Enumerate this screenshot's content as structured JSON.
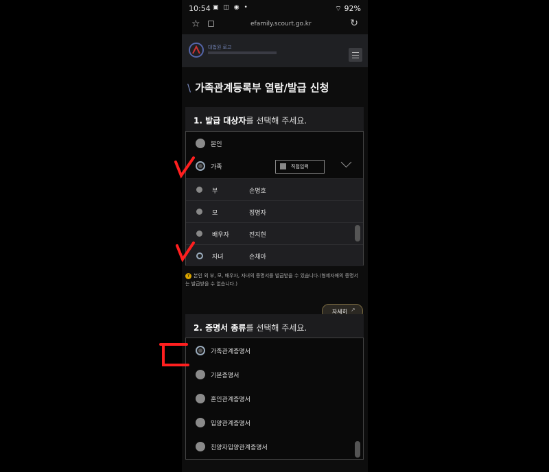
{
  "status_bar": {
    "time": "10:54",
    "battery": "92%"
  },
  "browser": {
    "url": "efamily.scourt.go.kr"
  },
  "site": {
    "logo_text": "대법원 로고"
  },
  "page": {
    "title": "가족관계등록부 열람/발급 신청"
  },
  "section1": {
    "heading_bold": "1. 발급 대상자",
    "heading_rest": "를 선택해 주세요.",
    "options": [
      {
        "label": "본인",
        "selected": false
      },
      {
        "label": "가족",
        "selected": true
      }
    ],
    "direct_input_label": "직접입력",
    "family_members": [
      {
        "relation": "부",
        "name": "손명호",
        "selected": false
      },
      {
        "relation": "모",
        "name": "정명자",
        "selected": false
      },
      {
        "relation": "배우자",
        "name": "전지현",
        "selected": false
      },
      {
        "relation": "자녀",
        "name": "손채아",
        "selected": true
      }
    ]
  },
  "notice": {
    "icon": "question-icon",
    "text": "본인 외 부, 모, 배우자, 자녀의 증명서를 발급받을 수 있습니다.(형제자매의 증명서는 발급받을 수 없습니다.)"
  },
  "detail_button": {
    "label": "자세히"
  },
  "section2": {
    "heading_bold": "2. 증명서 종류",
    "heading_rest": "를 선택해 주세요.",
    "options": [
      {
        "label": "가족관계증명서",
        "selected": true
      },
      {
        "label": "기본증명서",
        "selected": false
      },
      {
        "label": "혼인관계증명서",
        "selected": false
      },
      {
        "label": "입양관계증명서",
        "selected": false
      },
      {
        "label": "친양자입양관계증명서",
        "selected": false
      }
    ]
  },
  "colors": {
    "annotation": "#ff1f1f",
    "selected_ring": "#99aabb",
    "background": "#0d0d0d"
  }
}
